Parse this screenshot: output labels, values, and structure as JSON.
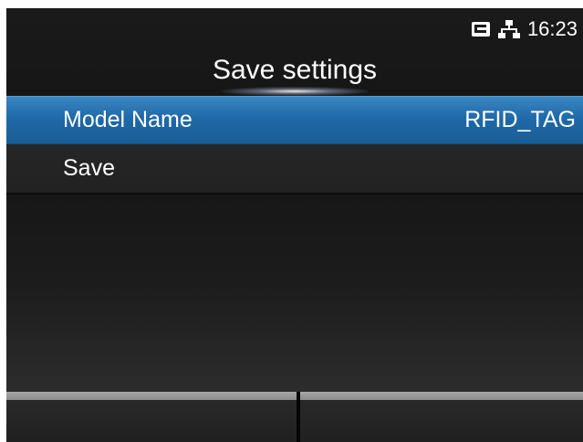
{
  "status_bar": {
    "time": "16:23",
    "icons": [
      "sd-card-icon",
      "network-icon"
    ]
  },
  "title": "Save settings",
  "menu": {
    "items": [
      {
        "label": "Model Name",
        "value": "RFID_TAG",
        "selected": true
      },
      {
        "label": "Save",
        "value": "",
        "selected": false
      }
    ]
  },
  "softkeys": {
    "left": "",
    "right": ""
  },
  "colors": {
    "selection": "#1f6aa8",
    "background": "#1a1a1a",
    "text": "#ffffff"
  }
}
